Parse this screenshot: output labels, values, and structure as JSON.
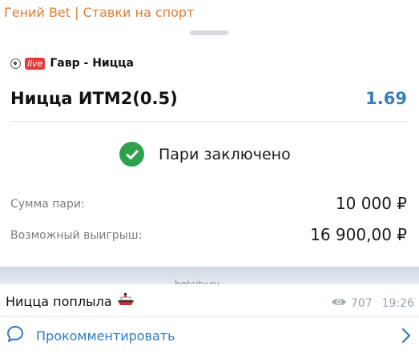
{
  "channel": {
    "title": "Гений Bet | Ставки на спорт"
  },
  "ticket": {
    "live_label": "live",
    "event": "Гавр - Ницца",
    "bet": "Ницца ИТМ2(0.5)",
    "odds": "1.69",
    "status": "Пари заключено",
    "stake_label": "Сумма пари:",
    "stake_value": "10 000 ₽",
    "payout_label": "Возможный выигрыш:",
    "payout_value": "16 900,00 ₽",
    "watermark": "betcity.ru"
  },
  "message": {
    "caption": "Ницца поплыла",
    "views": "707",
    "time": "19:26",
    "comment_label": "Прокомментировать"
  },
  "colors": {
    "channel": "#e07c2f",
    "odds": "#3b7eb6",
    "success": "#2fa14c",
    "live": "#e23b3b",
    "link": "#2d7cc1"
  },
  "icons": [
    "soccer-ball-icon",
    "check-circle-icon",
    "ship-emoji-icon",
    "eye-icon",
    "comment-bubble-icon",
    "chevron-right-icon"
  ]
}
